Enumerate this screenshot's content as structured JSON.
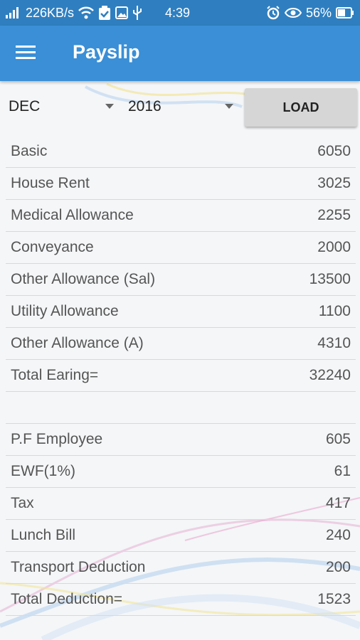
{
  "status_bar": {
    "net_speed": "226KB/s",
    "time": "4:39",
    "battery": "56%"
  },
  "app_bar": {
    "title": "Payslip",
    "menu_icon": "hamburger-menu-icon"
  },
  "filters": {
    "month": "DEC",
    "year": "2016",
    "load_label": "LOAD"
  },
  "earnings": [
    {
      "label": "Basic",
      "value": "6050"
    },
    {
      "label": "House Rent",
      "value": "3025"
    },
    {
      "label": "Medical Allowance",
      "value": "2255"
    },
    {
      "label": "Conveyance",
      "value": "2000"
    },
    {
      "label": "Other Allowance (Sal)",
      "value": "13500"
    },
    {
      "label": "Utility Allowance",
      "value": "1100"
    },
    {
      "label": "Other Allowance (A)",
      "value": "4310"
    },
    {
      "label": "Total Earing=",
      "value": "32240"
    }
  ],
  "deductions": [
    {
      "label": "P.F Employee",
      "value": "605"
    },
    {
      "label": "EWF(1%)",
      "value": "61"
    },
    {
      "label": "Tax",
      "value": "417"
    },
    {
      "label": "Lunch Bill",
      "value": "240"
    },
    {
      "label": "Transport Deduction",
      "value": "200"
    },
    {
      "label": "Total Deduction=",
      "value": "1523"
    }
  ],
  "colors": {
    "status_bar": "#2f7fc0",
    "app_bar": "#3a8fd6",
    "divider": "#d7dadd"
  }
}
